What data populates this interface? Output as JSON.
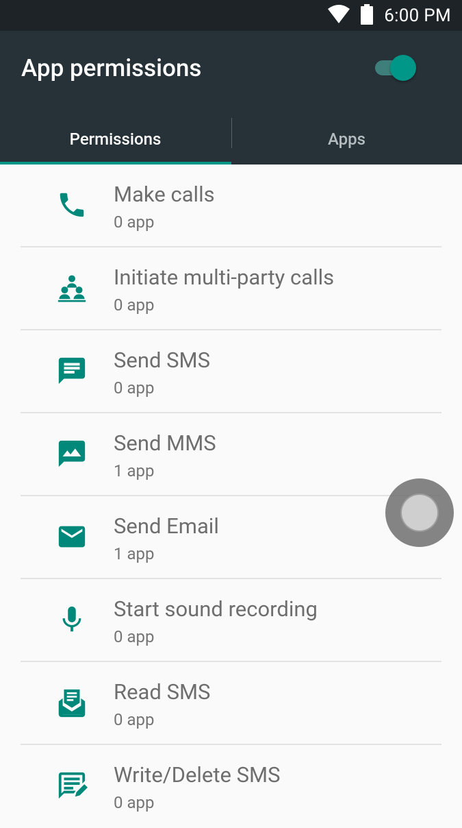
{
  "status_bar": {
    "time": "6:00 PM",
    "icons": [
      "wifi-icon",
      "battery-icon"
    ]
  },
  "app_bar": {
    "title": "App permissions",
    "toggle_on": true
  },
  "tabs": [
    {
      "label": "Permissions",
      "selected": true
    },
    {
      "label": "Apps",
      "selected": false
    }
  ],
  "permissions": [
    {
      "label": "Make calls",
      "count": "0 app",
      "icon": "phone-icon"
    },
    {
      "label": "Initiate multi-party calls",
      "count": "0 app",
      "icon": "group-icon"
    },
    {
      "label": "Send SMS",
      "count": "0 app",
      "icon": "message-icon"
    },
    {
      "label": "Send MMS",
      "count": "1 app",
      "icon": "mms-icon"
    },
    {
      "label": "Send Email",
      "count": "1 app",
      "icon": "email-icon"
    },
    {
      "label": "Start sound recording",
      "count": "0 app",
      "icon": "mic-icon"
    },
    {
      "label": "Read SMS",
      "count": "0 app",
      "icon": "read-sms-icon"
    },
    {
      "label": "Write/Delete SMS",
      "count": "0 app",
      "icon": "write-sms-icon"
    }
  ],
  "colors": {
    "accent": "#009688",
    "app_bar": "#263238",
    "status_bar": "#1d2327",
    "background": "#fafafa"
  }
}
